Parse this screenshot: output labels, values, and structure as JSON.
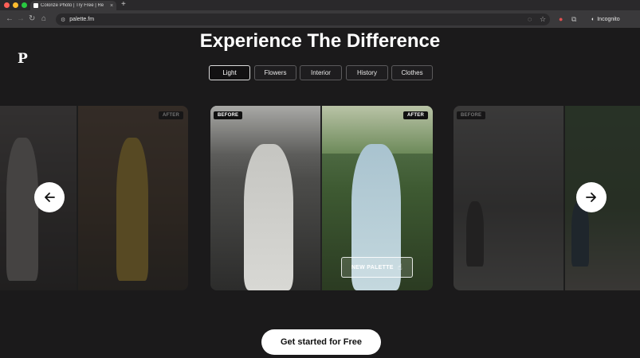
{
  "browser": {
    "tab_title": "Colorize Photo | Try Free | Re",
    "favicon_letter": "P",
    "url": "palette.fm",
    "profile_label": "Incognito"
  },
  "page": {
    "logo": "P",
    "headline": "Experience The Difference",
    "filters": [
      "Light",
      "Flowers",
      "Interior",
      "History",
      "Clothes"
    ],
    "active_filter": "Light",
    "badges": {
      "before": "BEFORE",
      "after": "AFTER"
    },
    "new_palette_label": "NEW PALETTE",
    "cta_label": "Get started for Free"
  },
  "icons": {
    "prev": "arrow-left-icon",
    "next": "arrow-right-icon",
    "pointer": "hand-pointer-icon"
  }
}
